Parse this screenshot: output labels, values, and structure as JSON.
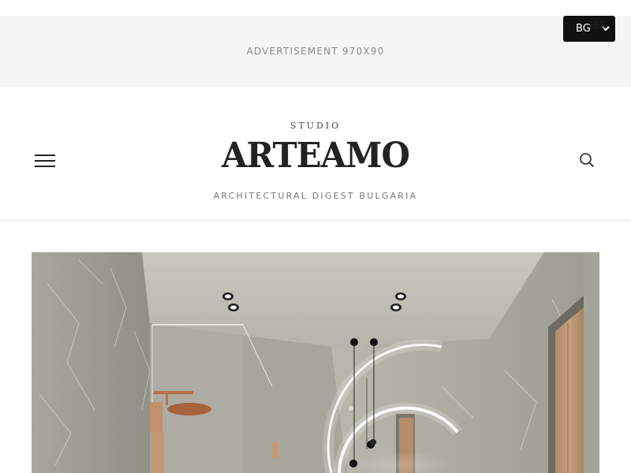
{
  "ad": {
    "label": "ADVERTISEMENT 970X90"
  },
  "language": {
    "selected": "BG",
    "overlay": "BG"
  },
  "header": {
    "studio": "STUDIO",
    "brand": "ARTEAMO",
    "tagline": "ARCHITECTURAL DIGEST BULGARIA"
  },
  "icons": {
    "menu": "hamburger-icon",
    "search": "search-icon",
    "select": "chevron-down-icon"
  },
  "colors": {
    "ad_bg": "#f5f5f5",
    "select_bg": "#111111",
    "text": "#222222",
    "muted": "#777777"
  }
}
